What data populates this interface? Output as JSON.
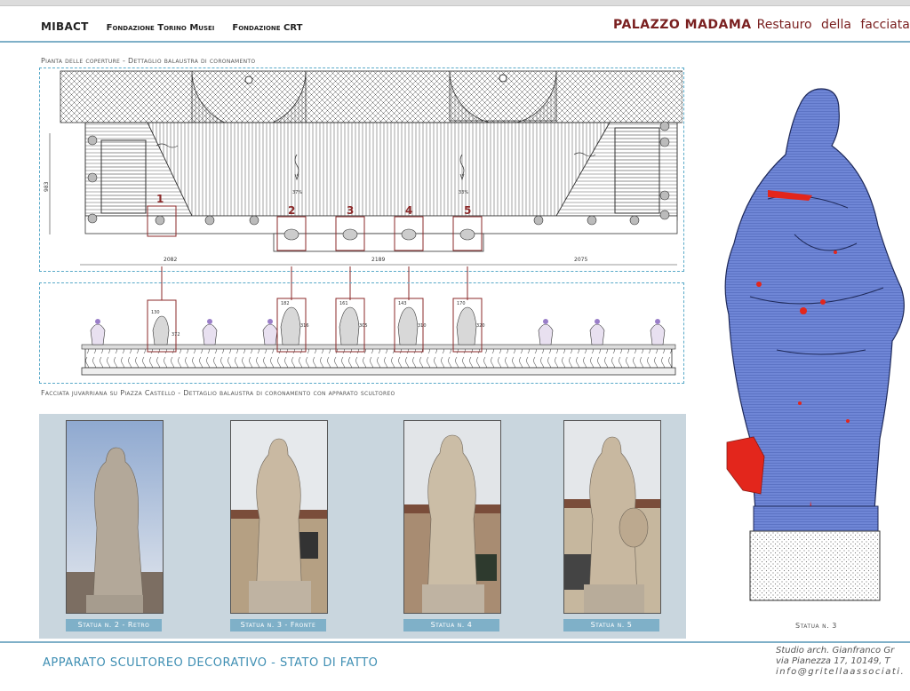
{
  "header": {
    "logos": [
      "MIBACT",
      "Fondazione Torino Musei",
      "Fondazione CRT"
    ],
    "project_name": "PALAZZO MADAMA",
    "project_sub": "Restauro della facciata juva"
  },
  "plan": {
    "caption": "Pianta delle coperture - Dettaglio balaustra di coronamento",
    "dimensions": [
      "2082",
      "2189",
      "2075"
    ],
    "height_dim": "983",
    "slope_labels": [
      "37%",
      "33%"
    ],
    "numbers": [
      "1",
      "2",
      "3",
      "4",
      "5"
    ]
  },
  "elevation": {
    "caption": "Facciata juvarriana su Piazza Castello - Dettaglio balaustra di coronamento con apparato scultoreo",
    "statue_dims": [
      {
        "w": "130",
        "h": "372"
      },
      {
        "w": "182",
        "h": "316"
      },
      {
        "w": "161",
        "h": "305"
      },
      {
        "w": "143",
        "h": "310"
      },
      {
        "w": "170",
        "h": "320"
      }
    ]
  },
  "photos": [
    {
      "label": "Statua n. 2 - Retro"
    },
    {
      "label": "Statua n. 3 - Fronte"
    },
    {
      "label": "Statua n. 4"
    },
    {
      "label": "Statua n. 5"
    }
  ],
  "statue3": {
    "caption": "Statua n. 3"
  },
  "footer": {
    "title": "APPARATO SCULTOREO DECORATIVO - STATO DI FATTO",
    "studio": "Studio arch. Gianfranco Gr",
    "address": "via Pianezza 17, 10149, T",
    "email": "info@gritellaassociati."
  },
  "colors": {
    "accent": "#7fb0c8",
    "title_red": "#7a2020",
    "footer_blue": "#3f8fb3",
    "marker_red": "#8b2a2a",
    "statue_blue": "#6f86d6",
    "damage_red": "#e3261c"
  }
}
